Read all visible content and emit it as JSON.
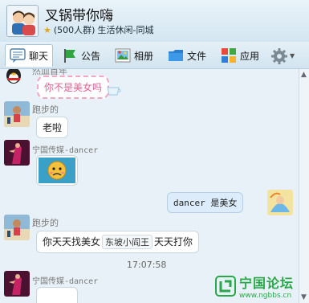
{
  "header": {
    "group_name": "叉锅带你嗨",
    "member_count": "(500人群)",
    "category": "生活休闲-同城"
  },
  "toolbar": {
    "tabs": [
      {
        "label": "聊天",
        "icon": "chat-icon",
        "active": true
      },
      {
        "label": "公告",
        "icon": "flag-icon",
        "active": false
      },
      {
        "label": "相册",
        "icon": "photo-icon",
        "active": false
      },
      {
        "label": "文件",
        "icon": "folder-icon",
        "active": false
      },
      {
        "label": "应用",
        "icon": "apps-icon",
        "active": false
      }
    ],
    "settings_icon": "gear-icon"
  },
  "messages": [
    {
      "sender": "然血首年",
      "text": "你不是美女吗",
      "style": "pink"
    },
    {
      "sender": "跑步的",
      "text": "老啦"
    },
    {
      "sender": "宁国传媒-dancer",
      "text": "",
      "emoji": "sad-face-emoji"
    },
    {
      "sender": "",
      "text": "dancer  是美女",
      "self": true
    },
    {
      "sender": "跑步的",
      "text_before": "你天天找美女",
      "mention": "东坡小阎王",
      "text_after": "天天打你"
    },
    {
      "timestamp": "17:07:58"
    },
    {
      "sender": "宁国传媒-dancer"
    }
  ],
  "watermark": {
    "title": "宁国论坛",
    "url": "www.ngbbs.cn"
  },
  "colors": {
    "accent": "#29a84a",
    "bubble_pink_border": "#f2a6c2",
    "bubble_self": "#dcecfa"
  }
}
